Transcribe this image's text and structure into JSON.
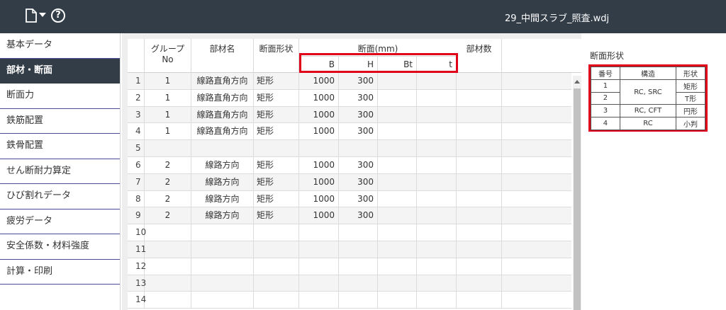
{
  "topbar": {
    "title": "29_中間スラブ_照査.wdj",
    "file_icon": "file-icon",
    "help_icon": "help-icon",
    "help_glyph": "?"
  },
  "sidebar": {
    "items": [
      {
        "label": "基本データ"
      },
      {
        "label": "部材・断面",
        "active": true
      },
      {
        "label": "断面力"
      },
      {
        "label": "鉄筋配置"
      },
      {
        "label": "鉄骨配置"
      },
      {
        "label": "せん断耐力算定"
      },
      {
        "label": "ひび割れデータ"
      },
      {
        "label": "疲労データ"
      },
      {
        "label": "安全係数・材料強度"
      },
      {
        "label": "計算・印刷"
      }
    ]
  },
  "grid": {
    "headers": {
      "group_line1": "グループ",
      "group_line2": "No",
      "member_name": "部材名",
      "section_shape": "断面形状",
      "section": "断面(mm)",
      "b": "B",
      "h": "H",
      "bt": "Bt",
      "t": "t",
      "member_count": "部材数"
    },
    "rows": [
      {
        "idx": "1",
        "group": "1",
        "name": "線路直角方向",
        "shape": "矩形",
        "b": "1000",
        "h": "300"
      },
      {
        "idx": "2",
        "group": "1",
        "name": "線路直角方向",
        "shape": "矩形",
        "b": "1000",
        "h": "300"
      },
      {
        "idx": "3",
        "group": "1",
        "name": "線路直角方向",
        "shape": "矩形",
        "b": "1000",
        "h": "300"
      },
      {
        "idx": "4",
        "group": "1",
        "name": "線路直角方向",
        "shape": "矩形",
        "b": "1000",
        "h": "300"
      },
      {
        "idx": "5",
        "group": "",
        "name": "",
        "shape": "",
        "b": "",
        "h": ""
      },
      {
        "idx": "6",
        "group": "2",
        "name": "線路方向",
        "shape": "矩形",
        "b": "1000",
        "h": "300"
      },
      {
        "idx": "7",
        "group": "2",
        "name": "線路方向",
        "shape": "矩形",
        "b": "1000",
        "h": "300"
      },
      {
        "idx": "8",
        "group": "2",
        "name": "線路方向",
        "shape": "矩形",
        "b": "1000",
        "h": "300"
      },
      {
        "idx": "9",
        "group": "2",
        "name": "線路方向",
        "shape": "矩形",
        "b": "1000",
        "h": "300"
      },
      {
        "idx": "10",
        "group": "",
        "name": "",
        "shape": "",
        "b": "",
        "h": ""
      },
      {
        "idx": "11",
        "group": "",
        "name": "",
        "shape": "",
        "b": "",
        "h": ""
      },
      {
        "idx": "12",
        "group": "",
        "name": "",
        "shape": "",
        "b": "",
        "h": ""
      },
      {
        "idx": "13",
        "group": "",
        "name": "",
        "shape": "",
        "b": "",
        "h": ""
      },
      {
        "idx": "14",
        "group": "",
        "name": "",
        "shape": "",
        "b": "",
        "h": ""
      }
    ]
  },
  "legend": {
    "title": "断面形状",
    "headers": [
      "番号",
      "構造",
      "形状"
    ],
    "rows": [
      {
        "no": "1",
        "structure": "RC, SRC",
        "shape": "矩形"
      },
      {
        "no": "2",
        "structure": "",
        "shape": "T形"
      },
      {
        "no": "3",
        "structure": "RC, CFT",
        "shape": "円形"
      },
      {
        "no": "4",
        "structure": "RC",
        "shape": "小判"
      }
    ]
  },
  "colors": {
    "topbar": "#333d48",
    "active_item": "#333d48",
    "highlight": "#e0001a",
    "sidebar_divider": "#4a4a9a"
  }
}
